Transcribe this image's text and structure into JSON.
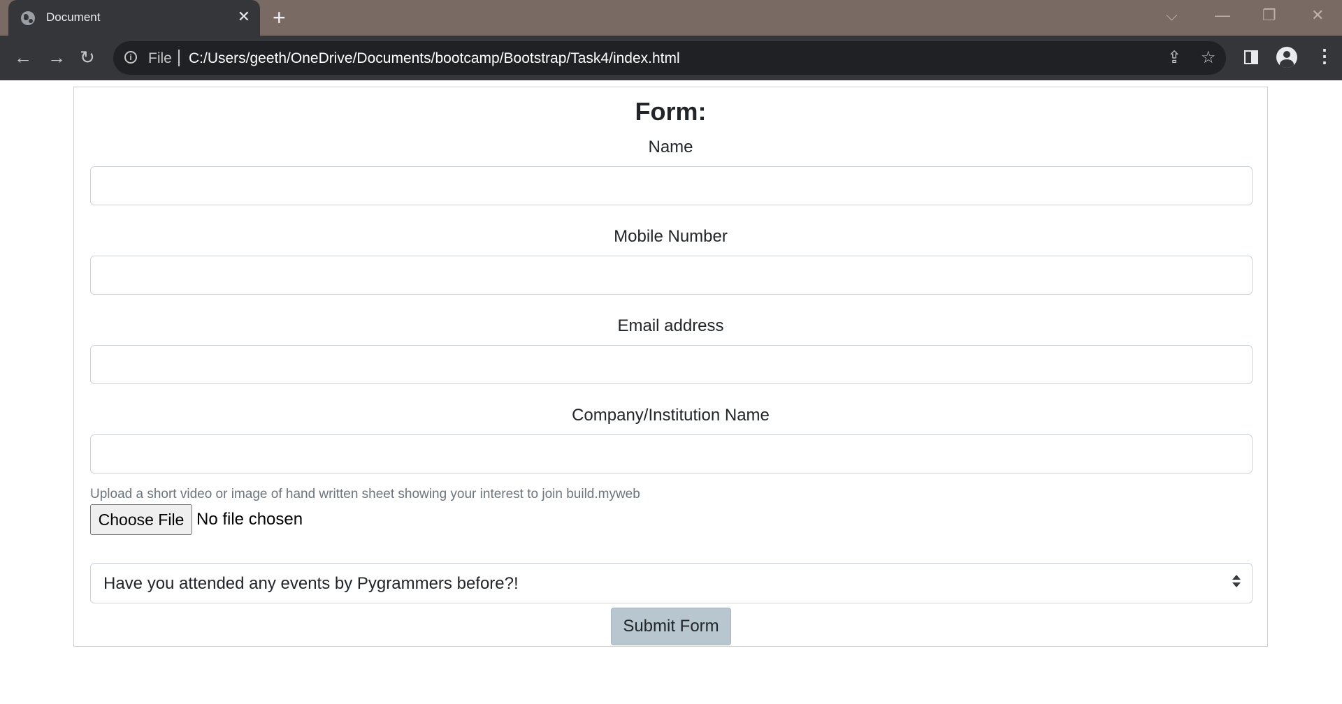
{
  "browser": {
    "tab_title": "Document",
    "tab_close_icon": "close-icon",
    "new_tab_icon": "plus-icon",
    "address": {
      "scheme_label": "File",
      "url": "C:/Users/geeth/OneDrive/Documents/bootcamp/Bootstrap/Task4/index.html"
    },
    "icons": [
      "back-arrow-icon",
      "forward-arrow-icon",
      "reload-icon",
      "info-icon",
      "share-icon",
      "star-icon",
      "side-panel-icon",
      "profile-icon",
      "kebab-menu-icon"
    ]
  },
  "form": {
    "heading": "Form:",
    "fields": [
      {
        "label": "Name",
        "value": ""
      },
      {
        "label": "Mobile Number",
        "value": ""
      },
      {
        "label": "Email address",
        "value": ""
      },
      {
        "label": "Company/Institution Name",
        "value": ""
      }
    ],
    "upload": {
      "help_text": "Upload a short video or image of hand written sheet showing your interest to join build.myweb",
      "button_label": "Choose File",
      "status": "No file chosen"
    },
    "select": {
      "selected": "Have you attended any events by Pygrammers before?!"
    },
    "submit_label": "Submit Form"
  },
  "colors": {
    "titlebar": "#7a6a64",
    "toolbar": "#35363a",
    "submit_button": "#b8c6d0"
  }
}
